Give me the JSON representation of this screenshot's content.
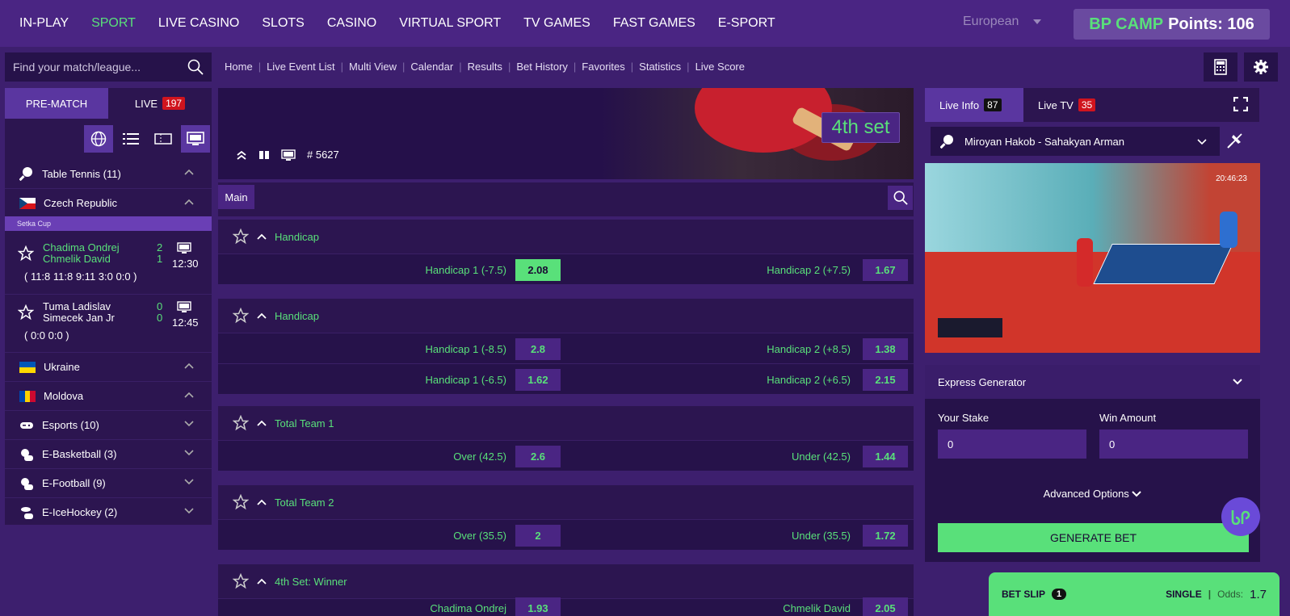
{
  "nav": {
    "items": [
      "IN-PLAY",
      "SPORT",
      "LIVE CASINO",
      "SLOTS",
      "CASINO",
      "VIRTUAL SPORT",
      "TV GAMES",
      "FAST GAMES",
      "E-SPORT"
    ],
    "active_index": 1,
    "odds_format": "European",
    "bp_camp_brand": "BP CAMP",
    "bp_camp_points": "Points: 106"
  },
  "search": {
    "placeholder": "Find your match/league..."
  },
  "links": [
    "Home",
    "Live Event List",
    "Multi View",
    "Calendar",
    "Results",
    "Bet History",
    "Favorites",
    "Statistics",
    "Live Score"
  ],
  "left_tabs": {
    "prematch": "PRE-MATCH",
    "live": "LIVE",
    "live_count": "197"
  },
  "sidebar": {
    "table_tennis": "Table Tennis (11)",
    "czech": "Czech Republic",
    "league": "Setka Cup",
    "matches": [
      {
        "team1": "Chadima Ondrej",
        "team2": "Chmelik David",
        "score1": "2",
        "score2": "1",
        "time": "12:30",
        "sets": "( 11:8   11:8   9:11   3:0   0:0 )"
      },
      {
        "team1": "Tuma Ladislav",
        "team2": "Simecek Jan Jr",
        "score1": "0",
        "score2": "0",
        "time": "12:45",
        "sets": "( 0:0   0:0 )"
      }
    ],
    "ukraine": "Ukraine",
    "moldova": "Moldova",
    "esports": "Esports (10)",
    "ebasketball": "E-Basketball (3)",
    "efootball": "E-Football (9)",
    "eicehockey": "E-IceHockey (2)"
  },
  "banner": {
    "set": "4th set",
    "event_id": "# 5627"
  },
  "main_tab": "Main",
  "markets": [
    {
      "title": "Handicap",
      "rows": [
        {
          "l": "Handicap 1 (-7.5)",
          "lo": "2.08",
          "r": "Handicap 2 (+7.5)",
          "ro": "1.67"
        }
      ]
    },
    {
      "title": "Handicap",
      "rows": [
        {
          "l": "Handicap 1 (-8.5)",
          "lo": "2.8",
          "r": "Handicap 2 (+8.5)",
          "ro": "1.38"
        },
        {
          "l": "Handicap 1 (-6.5)",
          "lo": "1.62",
          "r": "Handicap 2 (+6.5)",
          "ro": "2.15"
        }
      ]
    },
    {
      "title": "Total Team 1",
      "rows": [
        {
          "l": "Over (42.5)",
          "lo": "2.6",
          "r": "Under (42.5)",
          "ro": "1.44"
        }
      ]
    },
    {
      "title": "Total Team 2",
      "rows": [
        {
          "l": "Over (35.5)",
          "lo": "2",
          "r": "Under (35.5)",
          "ro": "1.72"
        }
      ]
    },
    {
      "title": "4th Set: Winner",
      "rows": [
        {
          "l": "Chadima Ondrej",
          "lo": "1.93",
          "r": "Chmelik David",
          "ro": "2.05"
        }
      ]
    }
  ],
  "right": {
    "live_info": "Live Info",
    "live_info_count": "87",
    "live_tv": "Live TV",
    "live_tv_count": "35",
    "match": "Miroyan Hakob - Sahakyan Arman",
    "video_time": "20:46:23",
    "express_title": "Express Generator",
    "stake_label": "Your Stake",
    "stake_value": "0",
    "win_label": "Win Amount",
    "win_value": "0",
    "advanced": "Advanced Options",
    "generate": "GENERATE BET"
  },
  "betslip": {
    "label": "BET SLIP",
    "count": "1",
    "type": "SINGLE",
    "odds_label": "Odds:",
    "odds": "1.7"
  },
  "colors": {
    "accent": "#59e07a",
    "bg": "#3d1f6e",
    "panel": "#26124a",
    "live_badge": "#d0141e"
  }
}
